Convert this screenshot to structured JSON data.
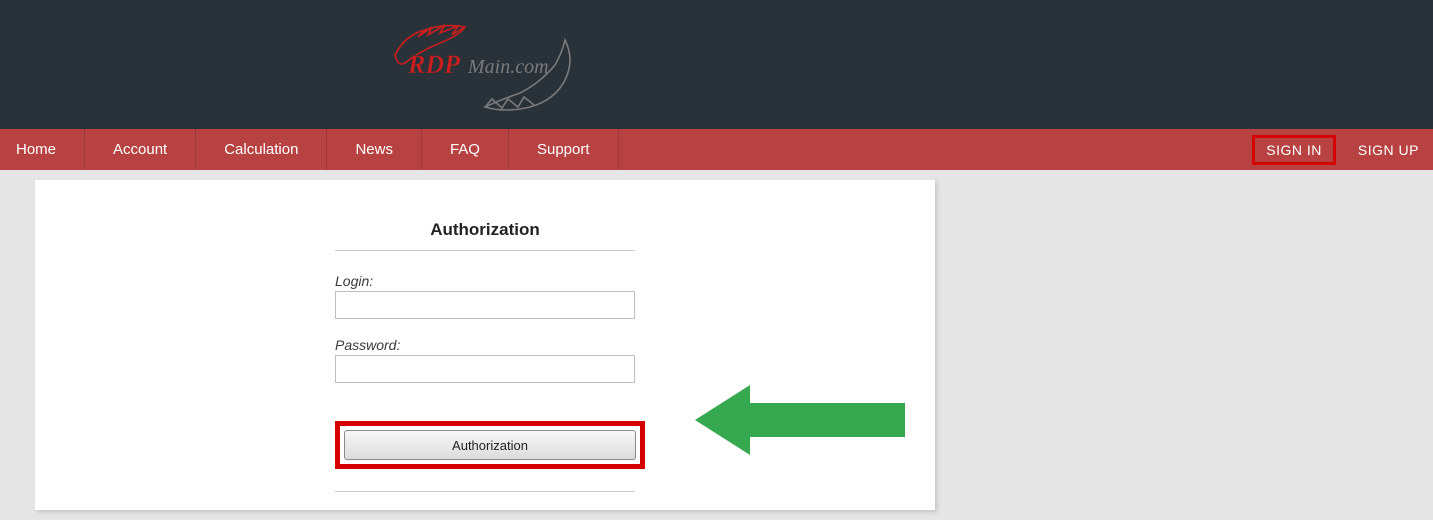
{
  "logo": {
    "prefix": "RDP",
    "suffix": "Main.com"
  },
  "nav": {
    "items": [
      "Home",
      "Account",
      "Calculation",
      "News",
      "FAQ",
      "Support"
    ],
    "signin": "SIGN IN",
    "signup": "SIGN UP"
  },
  "form": {
    "title": "Authorization",
    "login_label": "Login:",
    "password_label": "Password:",
    "login_value": "",
    "password_value": "",
    "button": "Authorization"
  },
  "colors": {
    "header_bg": "#2a3239",
    "nav_bg": "#b84242",
    "highlight": "#d60000",
    "arrow": "#36a84f"
  }
}
